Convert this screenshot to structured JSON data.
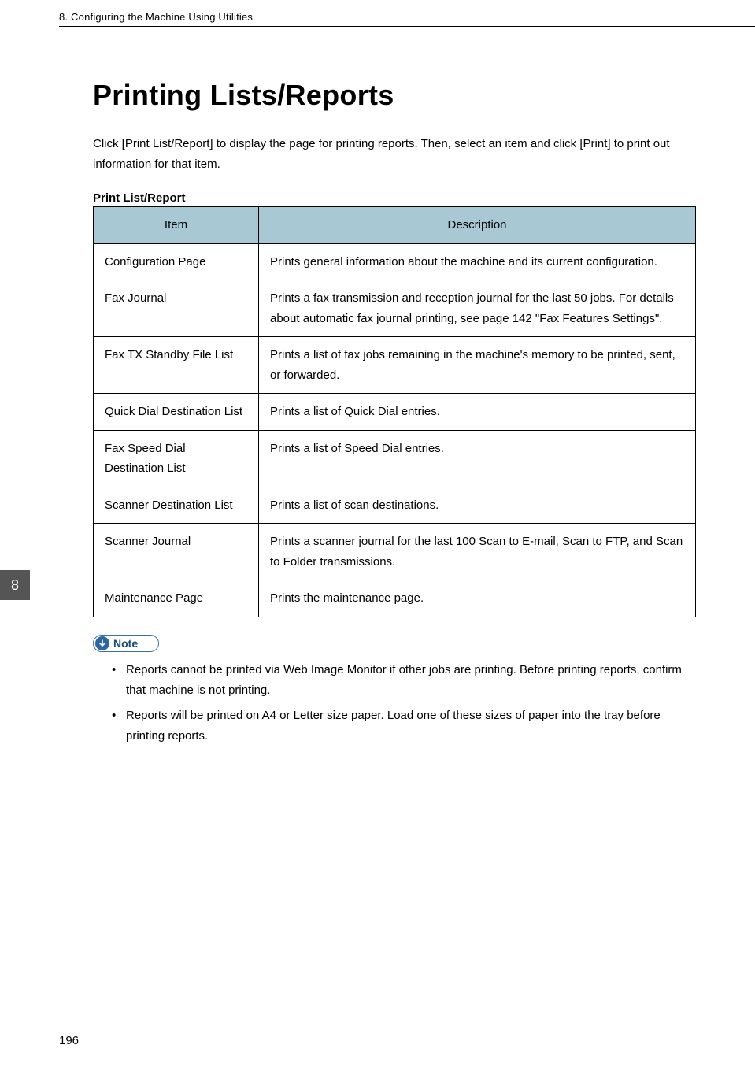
{
  "header": {
    "chapter": "8. Configuring the Machine Using Utilities"
  },
  "title": "Printing Lists/Reports",
  "intro": "Click [Print List/Report] to display the page for printing reports. Then, select an item and click [Print] to print out information for that item.",
  "table": {
    "caption": "Print List/Report",
    "cols": [
      "Item",
      "Description"
    ],
    "rows": [
      {
        "item": "Configuration Page",
        "desc": "Prints general information about the machine and its current configuration."
      },
      {
        "item": "Fax Journal",
        "desc": "Prints a fax transmission and reception journal for the last 50 jobs. For details about automatic fax journal printing, see page 142 \"Fax Features Settings\"."
      },
      {
        "item": "Fax TX Standby File List",
        "desc": "Prints a list of fax jobs remaining in the machine's memory to be printed, sent, or forwarded."
      },
      {
        "item": "Quick Dial Destination List",
        "desc": "Prints a list of Quick Dial entries."
      },
      {
        "item": "Fax Speed Dial Destination List",
        "desc": "Prints a list of Speed Dial entries."
      },
      {
        "item": "Scanner Destination List",
        "desc": "Prints a list of scan destinations."
      },
      {
        "item": "Scanner Journal",
        "desc": "Prints a scanner journal for the last 100 Scan to E-mail, Scan to FTP, and Scan to Folder transmissions."
      },
      {
        "item": "Maintenance Page",
        "desc": "Prints the maintenance page."
      }
    ]
  },
  "note": {
    "label": "Note",
    "items": [
      "Reports cannot be printed via Web Image Monitor if other jobs are printing. Before printing reports, confirm that machine is not printing.",
      "Reports will be printed on A4 or Letter size paper. Load one of these sizes of paper into the tray before printing reports."
    ]
  },
  "sideTab": "8",
  "pageNumber": "196"
}
